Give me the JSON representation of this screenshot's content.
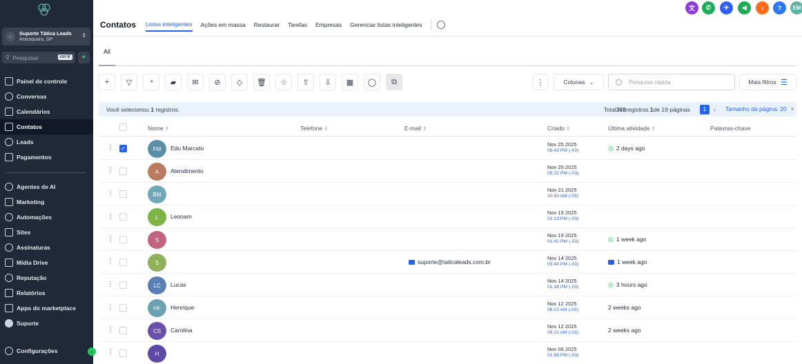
{
  "sidebar": {
    "account_name": "Suporte Tática Leads",
    "account_location": "Araraquara, SP",
    "search_placeholder": "Pesquisar",
    "search_shortcut": "ctrl K",
    "items": [
      {
        "label": "Painel de controle"
      },
      {
        "label": "Conversas"
      },
      {
        "label": "Calendários"
      },
      {
        "label": "Contatos"
      },
      {
        "label": "Leads"
      },
      {
        "label": "Pagamentos"
      },
      {
        "label": "Agentes de AI"
      },
      {
        "label": "Marketing"
      },
      {
        "label": "Automações"
      },
      {
        "label": "Sites"
      },
      {
        "label": "Assinaturas"
      },
      {
        "label": "Mídia Drive"
      },
      {
        "label": "Reputação"
      },
      {
        "label": "Relatórios"
      },
      {
        "label": "Apps do marketplace"
      },
      {
        "label": "Suporte"
      },
      {
        "label": "Configurações"
      }
    ]
  },
  "header": {
    "title": "Contatos",
    "tabs": [
      {
        "label": "Listas inteligentes"
      },
      {
        "label": "Ações em massa"
      },
      {
        "label": "Restaurar"
      },
      {
        "label": "Tarefas"
      },
      {
        "label": "Empresas"
      },
      {
        "label": "Gerenciar listas inteligentes"
      }
    ],
    "user_initials": "EM",
    "help_label": "?",
    "colors": {
      "purple": "#8b3bd9",
      "green": "#1faa59",
      "blue": "#2f5ff0",
      "orange": "#ff6b1a",
      "help": "#2b78f0",
      "user": "#5fb3a3"
    }
  },
  "subtab": {
    "label": "All"
  },
  "toolbar": {
    "columns_label": "Colunas",
    "search_placeholder": "Pesquisa rápida",
    "more_filters_label": "Mais filtros"
  },
  "selection": {
    "prefix": "Você selecionou ",
    "count": "1",
    "suffix": " registros.",
    "total_prefix": "Total ",
    "total": "368",
    "total_mid": " registros. ",
    "page": "1",
    "page_of": " de 19 páginas",
    "current_page": "1",
    "page_size_label": "Tamanho da página: 20"
  },
  "table": {
    "headers": {
      "name": "Nome",
      "phone": "Telefone",
      "email": "E-mail",
      "created": "Criado",
      "last_activity": "Última atividade",
      "keywords": "Palavras-chave"
    },
    "rows": [
      {
        "initials": "FM",
        "name": "Edu Marcato",
        "email": "",
        "date": "Nov 25 2025",
        "time": "06:43 PM (-03)",
        "activity": "2 days ago",
        "activity_icon": "whatsapp",
        "color": "#5b8fa8",
        "checked": true
      },
      {
        "initials": "A",
        "name": "Atendimento",
        "email": "",
        "date": "Nov 25 2025",
        "time": "05:22 PM (-03)",
        "activity": "",
        "activity_icon": "",
        "color": "#b97a5f",
        "checked": false
      },
      {
        "initials": "BM",
        "name": "",
        "email": "",
        "date": "Nov 21 2025",
        "time": "10:50 AM (-03)",
        "activity": "",
        "activity_icon": "",
        "color": "#6fa7b8",
        "checked": false
      },
      {
        "initials": "L",
        "name": "Leonam",
        "email": "",
        "date": "Nov 19 2025",
        "time": "02:13 PM (-03)",
        "activity": "",
        "activity_icon": "",
        "color": "#7cb342",
        "checked": false
      },
      {
        "initials": "S",
        "name": "",
        "email": "",
        "date": "Nov 19 2025",
        "time": "01:42 PM (-03)",
        "activity": "1 week ago",
        "activity_icon": "whatsapp",
        "color": "#c0647f",
        "checked": false
      },
      {
        "initials": "S",
        "name": "",
        "email": "suporte@taticaleads.com.br",
        "date": "Nov 14 2025",
        "time": "03:44 PM (-03)",
        "activity": "1 week ago",
        "activity_icon": "mail",
        "color": "#8fb15a",
        "checked": false
      },
      {
        "initials": "LC",
        "name": "Lucas",
        "email": "",
        "date": "Nov 14 2025",
        "time": "01:38 PM (-03)",
        "activity": "3 hours ago",
        "activity_icon": "whatsapp",
        "color": "#5a7fb5",
        "checked": false
      },
      {
        "initials": "HF",
        "name": "Henrique",
        "email": "",
        "date": "Nov 12 2025",
        "time": "08:22 AM (-03)",
        "activity": "2 weeks ago",
        "activity_icon": "",
        "color": "#6aa0b2",
        "checked": false
      },
      {
        "initials": "CS",
        "name": "Carolina",
        "email": "",
        "date": "Nov 12 2025",
        "time": "08:21 AM (-03)",
        "activity": "2 weeks ago",
        "activity_icon": "",
        "color": "#6b4fa8",
        "checked": false
      },
      {
        "initials": "H",
        "name": "",
        "email": "",
        "date": "Nov 06 2025",
        "time": "01:56 PM (-03)",
        "activity": "",
        "activity_icon": "",
        "color": "#5e4aa6",
        "checked": false
      }
    ]
  }
}
